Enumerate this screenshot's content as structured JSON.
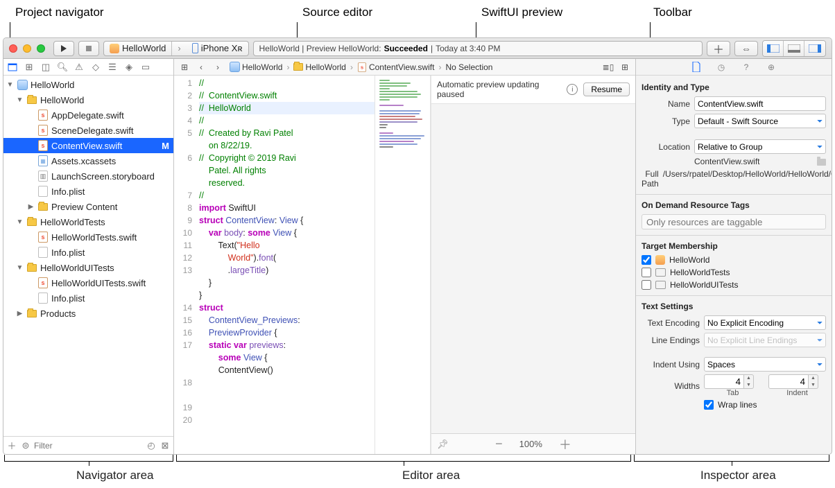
{
  "annotations": {
    "top": {
      "proj_nav": "Project navigator",
      "src_editor": "Source editor",
      "preview": "SwiftUI preview",
      "toolbar": "Toolbar"
    },
    "bottom": {
      "nav_area": "Navigator area",
      "editor_area": "Editor area",
      "inspector_area": "Inspector area"
    }
  },
  "toolbar": {
    "scheme_app": "HelloWorld",
    "scheme_device": "iPhone Xʀ",
    "activity_prefix": "HelloWorld | Preview HelloWorld: ",
    "activity_status": "Succeeded",
    "activity_sep": " | ",
    "activity_time": "Today at 3:40 PM"
  },
  "navigator": {
    "project": "HelloWorld",
    "groups": [
      {
        "name": "HelloWorld",
        "items": [
          {
            "name": "AppDelegate.swift",
            "icon": "swift"
          },
          {
            "name": "SceneDelegate.swift",
            "icon": "swift"
          },
          {
            "name": "ContentView.swift",
            "icon": "swift",
            "selected": true,
            "badge": "M"
          },
          {
            "name": "Assets.xcassets",
            "icon": "xc"
          },
          {
            "name": "LaunchScreen.storyboard",
            "icon": "sb"
          },
          {
            "name": "Info.plist",
            "icon": "plist"
          },
          {
            "name": "Preview Content",
            "icon": "folder",
            "disclosure": "▶"
          }
        ]
      },
      {
        "name": "HelloWorldTests",
        "items": [
          {
            "name": "HelloWorldTests.swift",
            "icon": "swift"
          },
          {
            "name": "Info.plist",
            "icon": "plist"
          }
        ]
      },
      {
        "name": "HelloWorldUITests",
        "items": [
          {
            "name": "HelloWorldUITests.swift",
            "icon": "swift"
          },
          {
            "name": "Info.plist",
            "icon": "plist"
          }
        ]
      },
      {
        "name": "Products",
        "items": [],
        "disclosure": "▶"
      }
    ],
    "filter_placeholder": "Filter"
  },
  "jumpbar": {
    "p0": "HelloWorld",
    "p1": "HelloWorld",
    "p2": "ContentView.swift",
    "p3": "No Selection"
  },
  "code": {
    "lines": [
      {
        "n": 1,
        "html": "<span class='c-comment'>//</span>"
      },
      {
        "n": 2,
        "html": "<span class='c-comment'>//  ContentView.swift</span>"
      },
      {
        "n": 3,
        "html": "<span class='c-comment'>//  HelloWorld</span>",
        "hl": true
      },
      {
        "n": 4,
        "html": "<span class='c-comment'>//</span>"
      },
      {
        "n": 5,
        "html": "<span class='c-comment'>//  Created by Ravi Patel\n    on 8/22/19.</span>"
      },
      {
        "n": 6,
        "html": "<span class='c-comment'>//  Copyright © 2019 Ravi\n    Patel. All rights\n    reserved.</span>"
      },
      {
        "n": 7,
        "html": "<span class='c-comment'>//</span>"
      },
      {
        "n": 8,
        "html": ""
      },
      {
        "n": 9,
        "html": "<span class='c-kw'>import</span> SwiftUI"
      },
      {
        "n": 10,
        "html": ""
      },
      {
        "n": 11,
        "html": "<span class='c-kw'>struct</span> <span class='c-type'>ContentView</span>: <span class='c-type'>View</span> {"
      },
      {
        "n": 12,
        "html": "    <span class='c-kw'>var</span> <span class='c-prop'>body</span>: <span class='c-kw'>some</span> <span class='c-type'>View</span> {"
      },
      {
        "n": 13,
        "html": "        Text(<span class='c-str'>\"Hello\n            World\"</span>).<span class='c-method'>font</span>(\n            .<span class='c-prop'>largeTitle</span>)"
      },
      {
        "n": 14,
        "html": "    }"
      },
      {
        "n": 15,
        "html": "}"
      },
      {
        "n": 16,
        "html": ""
      },
      {
        "n": 17,
        "html": "<span class='c-kw'>struct</span>\n    <span class='c-type'>ContentView_Previews</span>:\n    <span class='c-type'>PreviewProvider</span> {"
      },
      {
        "n": 18,
        "html": "    <span class='c-kw'>static</span> <span class='c-kw'>var</span> <span class='c-prop'>previews</span>:\n        <span class='c-kw'>some</span> <span class='c-type'>View</span> {"
      },
      {
        "n": 19,
        "html": "        ContentView()"
      },
      {
        "n": 20,
        "html": ""
      }
    ]
  },
  "preview": {
    "msg": "Automatic preview updating paused",
    "resume": "Resume",
    "zoom": "100%"
  },
  "inspector": {
    "identity_h": "Identity and Type",
    "name_l": "Name",
    "name_v": "ContentView.swift",
    "type_l": "Type",
    "type_v": "Default - Swift Source",
    "loc_l": "Location",
    "loc_v": "Relative to Group",
    "loc_file": "ContentView.swift",
    "fp_l": "Full Path",
    "fp_v": "/Users/rpatel/Desktop/HelloWorld/HelloWorld/ContentView.swift",
    "odr_h": "On Demand Resource Tags",
    "odr_ph": "Only resources are taggable",
    "tm_h": "Target Membership",
    "tm": [
      {
        "checked": true,
        "label": "HelloWorld",
        "icon": "app"
      },
      {
        "checked": false,
        "label": "HelloWorldTests",
        "icon": "bundle"
      },
      {
        "checked": false,
        "label": "HelloWorldUITests",
        "icon": "bundle"
      }
    ],
    "ts_h": "Text Settings",
    "enc_l": "Text Encoding",
    "enc_v": "No Explicit Encoding",
    "le_l": "Line Endings",
    "le_v": "No Explicit Line Endings",
    "ind_l": "Indent Using",
    "ind_v": "Spaces",
    "wid_l": "Widths",
    "tab_v": "4",
    "indent_v": "4",
    "tab_lab": "Tab",
    "indent_lab": "Indent",
    "wrap_l": "Wrap lines"
  }
}
